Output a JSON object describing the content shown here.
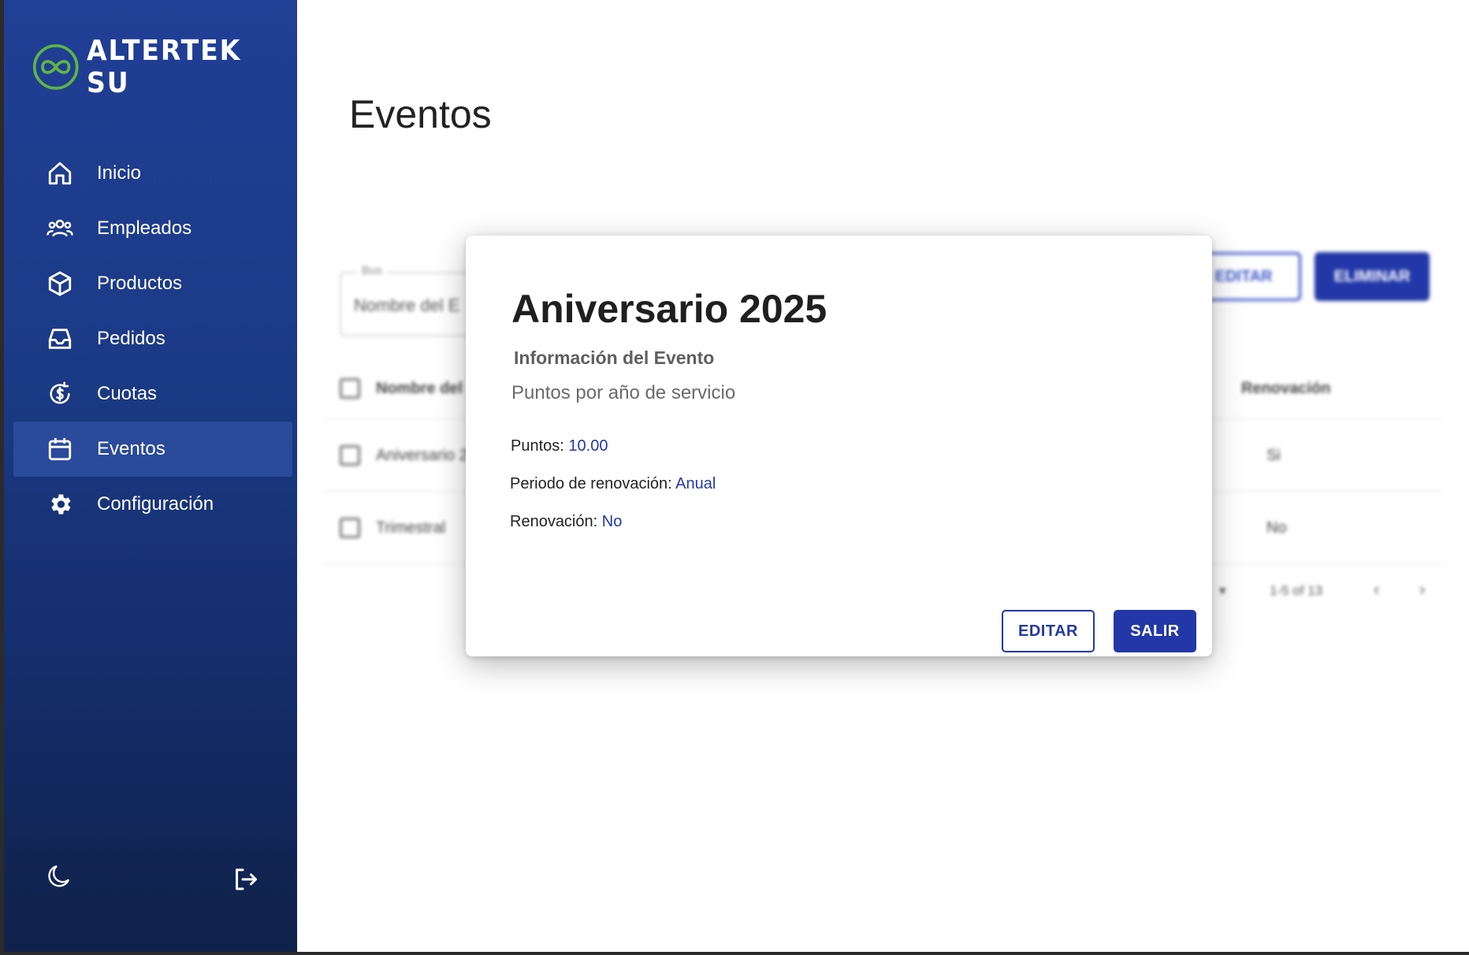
{
  "sidebar": {
    "logo_text_main": "ALTERTEK S",
    "logo_text_tail": "U",
    "items": [
      {
        "label": "Inicio",
        "icon": "home-icon"
      },
      {
        "label": "Empleados",
        "icon": "users-icon"
      },
      {
        "label": "Productos",
        "icon": "box-icon"
      },
      {
        "label": "Pedidos",
        "icon": "inbox-icon"
      },
      {
        "label": "Cuotas",
        "icon": "currency-refresh-icon"
      },
      {
        "label": "Eventos",
        "icon": "calendar-icon",
        "active": true
      },
      {
        "label": "Configuración",
        "icon": "gear-icon"
      }
    ],
    "bottom_icons": [
      "moon-icon",
      "logout-icon"
    ]
  },
  "page": {
    "title": "Eventos",
    "search": {
      "legend": "Bus",
      "placeholder": "Nombre del E"
    },
    "actions": {
      "edit": "EDITAR",
      "delete": "ELIMINAR"
    },
    "table": {
      "headers": {
        "name": "Nombre del",
        "renewal": "Renovación"
      },
      "rows": [
        {
          "name": "Aniversario 2",
          "renewal": "Si"
        },
        {
          "name": "Trimestral",
          "renewal": "No"
        }
      ]
    },
    "pagination": {
      "range": "1-5 of 13"
    }
  },
  "dialog": {
    "title": "Aniversario 2025",
    "subtitle": "Información del Evento",
    "description": "Puntos por año de servicio",
    "points_label": "Puntos:",
    "points_value": "10.00",
    "period_label": "Periodo de renovación:",
    "period_value": "Anual",
    "renewal_label": "Renovación:",
    "renewal_value": "No",
    "edit_button": "EDITAR",
    "exit_button": "SALIR"
  },
  "colors": {
    "sidebar_top": "#203f96",
    "sidebar_bottom": "#0f2149",
    "primary": "#2338a8",
    "logo_green": "#5fb544"
  }
}
